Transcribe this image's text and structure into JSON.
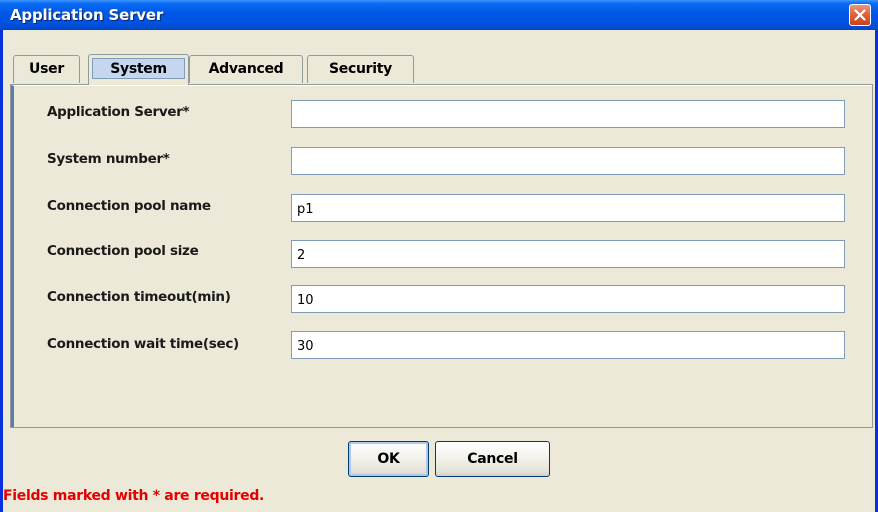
{
  "window": {
    "title": "Application Server"
  },
  "tabs": [
    {
      "label": "User",
      "selected": false
    },
    {
      "label": "System",
      "selected": true
    },
    {
      "label": "Advanced",
      "selected": false
    },
    {
      "label": "Security",
      "selected": false
    }
  ],
  "form": {
    "fields": [
      {
        "label": "Application Server*",
        "value": ""
      },
      {
        "label": "System number*",
        "value": ""
      },
      {
        "label": "Connection pool name",
        "value": "p1"
      },
      {
        "label": "Connection pool size",
        "value": "2"
      },
      {
        "label": "Connection timeout(min)",
        "value": "10"
      },
      {
        "label": "Connection wait time(sec)",
        "value": "30"
      }
    ]
  },
  "buttons": {
    "ok_label": "OK",
    "cancel_label": "Cancel"
  },
  "footer": {
    "required_note": "Fields marked with * are required."
  },
  "colors": {
    "titlebar": "#0054E3",
    "window_bg": "#ECE9D8",
    "required_note": "#E50000",
    "selected_tab": "#C6D6EE"
  },
  "icons": {
    "close": "close-icon"
  }
}
